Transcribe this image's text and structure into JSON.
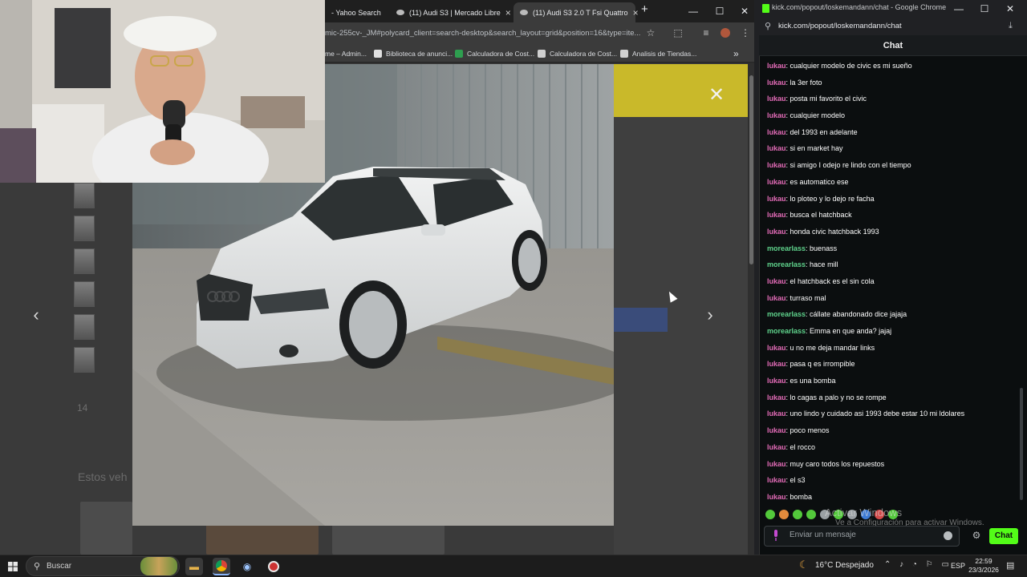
{
  "browser": {
    "tabs": [
      {
        "label": "- Yahoo Search"
      },
      {
        "label": "(11) Audi S3 | Mercado Libre"
      },
      {
        "label": "(11) Audi S3 2.0 T Fsi Quattro"
      }
    ],
    "new_tab": "+",
    "window_controls": {
      "minimize": "—",
      "maximize": "☐",
      "close": "✕"
    },
    "url": "mic-255cv-_JM#polycard_client=search-desktop&search_layout=grid&position=16&type=ite...",
    "bookmarks": [
      {
        "label": "me – Admin...",
        "color": "#3c3c3c"
      },
      {
        "label": "Biblioteca de anunci...",
        "color": "#e0e0e0"
      },
      {
        "label": "Calculadora de Cost...",
        "color": "#2e9e4f"
      },
      {
        "label": "Calculadora de Cost...",
        "color": "#d0d0d0"
      },
      {
        "label": "Analisis de Tiendas...",
        "color": "#d0d0d0"
      }
    ],
    "bookmarks_more": "»",
    "gallery": {
      "close_label": "✕",
      "prev_label": "‹",
      "next_label": "›",
      "thumb_count": "14",
      "similar_title": "Estos veh"
    }
  },
  "kick": {
    "window_title": "kick.com/popout/loskemandann/chat - Google Chrome",
    "url": "kick.com/popout/loskemandann/chat",
    "chat_header": "Chat",
    "user_colors": {
      "lukau": "#e36bb7",
      "morearlass": "#5fd38c"
    },
    "messages": [
      {
        "user": "lukau",
        "text": ": cualquier modelo de civic es mi sueño"
      },
      {
        "user": "lukau",
        "text": ": la 3er foto"
      },
      {
        "user": "lukau",
        "text": ": posta mi favorito el civic"
      },
      {
        "user": "lukau",
        "text": ": cualquier modelo"
      },
      {
        "user": "lukau",
        "text": ": del 1993 en adelante"
      },
      {
        "user": "lukau",
        "text": ": si en market hay"
      },
      {
        "user": "lukau",
        "text": ": si amigo I odejo re lindo con el tiempo"
      },
      {
        "user": "lukau",
        "text": ": es automatico ese"
      },
      {
        "user": "lukau",
        "text": ": lo ploteo y lo dejo re facha"
      },
      {
        "user": "lukau",
        "text": ": busca el hatchback"
      },
      {
        "user": "lukau",
        "text": ": honda civic hatchback 1993"
      },
      {
        "user": "morearlass",
        "text": ": buenass"
      },
      {
        "user": "morearlass",
        "text": ": hace mill"
      },
      {
        "user": "lukau",
        "text": ": el hatchback es el sin cola"
      },
      {
        "user": "lukau",
        "text": ": turraso mal"
      },
      {
        "user": "morearlass",
        "text": ": cállate abandonado dice jajaja"
      },
      {
        "user": "morearlass",
        "text": ": Emma en que anda? jajaj"
      },
      {
        "user": "lukau",
        "text": ": u no me deja mandar links"
      },
      {
        "user": "lukau",
        "text": ": pasa q es irrompible"
      },
      {
        "user": "lukau",
        "text": ": es una bomba"
      },
      {
        "user": "lukau",
        "text": ": lo cagas a palo y no se rompe"
      },
      {
        "user": "lukau",
        "text": ": uno lindo y cuidado asi 1993 debe estar 10 mi ldolares"
      },
      {
        "user": "lukau",
        "text": ": poco menos"
      },
      {
        "user": "lukau",
        "text": ": el rocco"
      },
      {
        "user": "lukau",
        "text": ": muy caro todos los repuestos"
      },
      {
        "user": "lukau",
        "text": ": el s3"
      },
      {
        "user": "lukau",
        "text": ": bomba"
      }
    ],
    "watermark_title": "Activar Windows",
    "watermark_sub": "Ve a Configuración para activar Windows.",
    "input_placeholder": "Enviar un mensaje",
    "send_label": "Chat",
    "settings_icon": "⚙"
  },
  "taskbar": {
    "search_label": "Buscar",
    "weather": "16°C  Despejado",
    "lang": "ESP",
    "time": "22:59",
    "date": "23/3/2026"
  }
}
